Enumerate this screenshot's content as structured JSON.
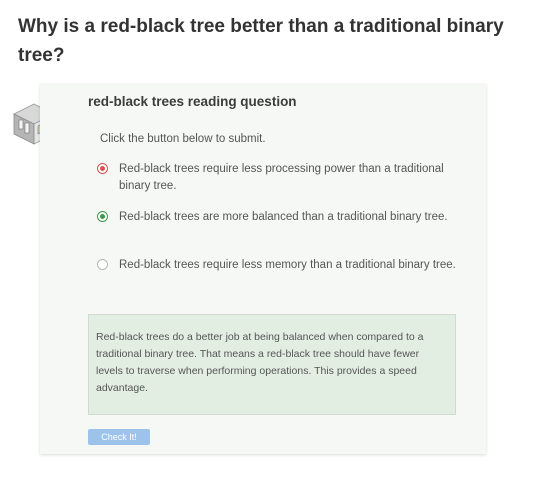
{
  "page": {
    "heading": "Why is a red-black tree better than a traditional binary tree?"
  },
  "quiz": {
    "icon": "quiz-building-icon",
    "title": "red-black trees reading question",
    "instruction": "Click the button below to submit.",
    "options": [
      {
        "label": "Red-black trees require less processing power than a traditional binary tree.",
        "state": "incorrect"
      },
      {
        "label": "Red-black trees are more balanced than a traditional binary tree.",
        "state": "correct"
      },
      {
        "label": "Red-black trees require less memory than a traditional binary tree.",
        "state": "unselected"
      }
    ],
    "feedback": "Red-black trees do a better job at being balanced when compared to a traditional binary tree. That means a red-black tree should have fewer levels to traverse when performing operations. This provides a speed advantage.",
    "submit_label": "Check It!"
  },
  "colors": {
    "incorrect": "#d9534f",
    "correct": "#3b9b4b",
    "button": "#9ec3eb",
    "feedback_bg": "#e3eee3"
  }
}
